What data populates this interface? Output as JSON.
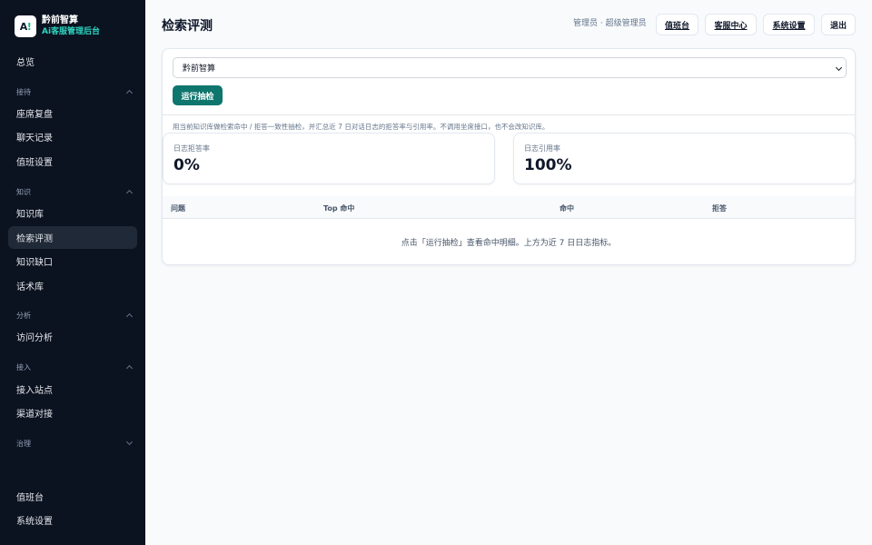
{
  "brand": {
    "logo": "A",
    "logo_mark": "!",
    "name": "黔前智算",
    "subtitle": "Ai客服管理后台"
  },
  "sidebar": {
    "overview": "总览",
    "groups": {
      "reception": "接待",
      "knowledge": "知识",
      "analysis": "分析",
      "access": "接入",
      "governance": "治理"
    },
    "items": {
      "seat_review": "座席复盘",
      "chat_logs": "聊天记录",
      "duty_settings": "值班设置",
      "knowledge_base": "知识库",
      "retrieval_eval": "检索评测",
      "knowledge_gaps": "知识缺口",
      "script_library": "话术库",
      "visit_analysis": "访问分析",
      "sites": "接入站点",
      "channels": "渠道对接",
      "duty_desk": "值班台",
      "system_settings": "系统设置"
    }
  },
  "header": {
    "title": "检索评测",
    "user": "管理员 · 超级管理员",
    "buttons": {
      "duty": "值班台",
      "service": "客服中心",
      "settings": "系统设置",
      "logout": "退出"
    }
  },
  "main": {
    "select_value": "黔前智算",
    "run_button": "运行抽检",
    "description": "用当前知识库做检索命中 / 拒答一致性抽检，并汇总近 7 日对话日志的拒答率与引用率。不调用坐席接口，也不会改知识库。",
    "stats": [
      {
        "label": "日志拒答率",
        "value": "0%"
      },
      {
        "label": "日志引用率",
        "value": "100%"
      }
    ],
    "table": {
      "columns": [
        "问题",
        "Top 命中",
        "命中",
        "拒答"
      ],
      "empty": "点击「运行抽检」查看命中明细。上方为近 7 日日志指标。"
    }
  },
  "colors": {
    "sidebar_bg": "#0b1220",
    "accent": "#0f766e",
    "brand_sub": "#2dd4bf"
  }
}
